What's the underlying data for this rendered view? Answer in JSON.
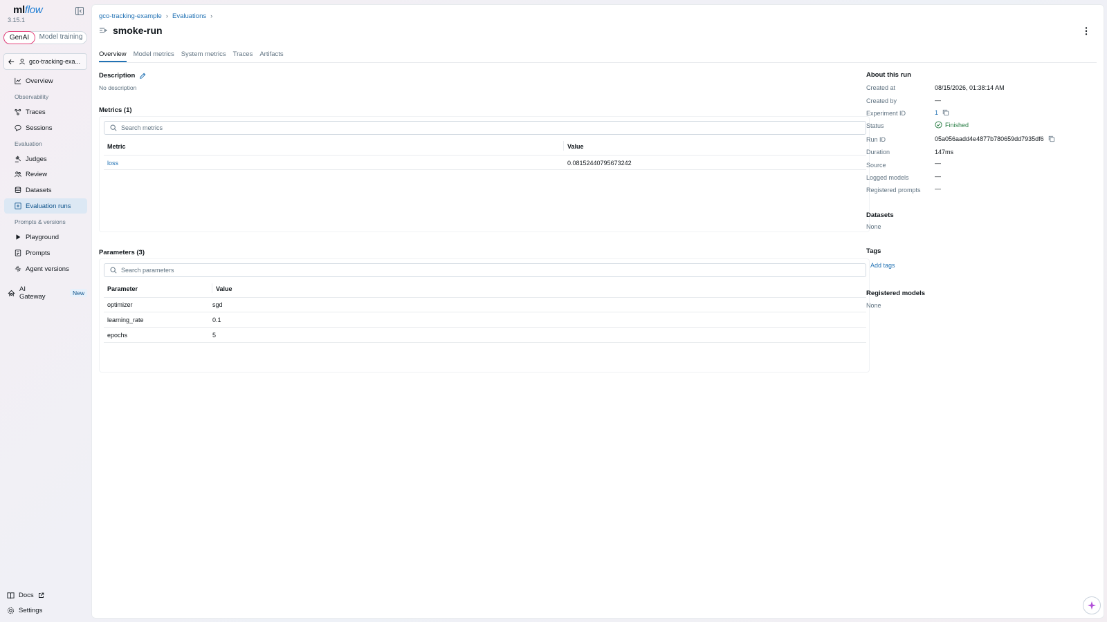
{
  "app": {
    "logo_main": "ml",
    "logo_accent": "flow",
    "version": "3.15.1"
  },
  "mode_switch": {
    "genai": "GenAI",
    "model_training": "Model training"
  },
  "experiment": {
    "name": "gco-tracking-exa..."
  },
  "sidebar": {
    "overview": "Overview",
    "group_observability": "Observability",
    "traces": "Traces",
    "sessions": "Sessions",
    "group_evaluation": "Evaluation",
    "judges": "Judges",
    "review": "Review",
    "datasets": "Datasets",
    "evaluation_runs": "Evaluation runs",
    "group_prompts": "Prompts & versions",
    "playground": "Playground",
    "prompts": "Prompts",
    "agent_versions": "Agent versions",
    "ai_gateway": "AI Gateway",
    "new_badge": "New",
    "docs": "Docs",
    "settings": "Settings"
  },
  "breadcrumb": {
    "experiment": "gco-tracking-example",
    "section": "Evaluations",
    "sep": "›"
  },
  "page": {
    "title": "smoke-run"
  },
  "tabs": [
    "Overview",
    "Model metrics",
    "System metrics",
    "Traces",
    "Artifacts"
  ],
  "description": {
    "title": "Description",
    "value": "No description"
  },
  "metrics": {
    "title": "Metrics (1)",
    "search_placeholder": "Search metrics",
    "col_metric": "Metric",
    "col_value": "Value",
    "rows": [
      {
        "name": "loss",
        "value": "0.08152440795673242"
      }
    ]
  },
  "parameters": {
    "title": "Parameters (3)",
    "search_placeholder": "Search parameters",
    "col_param": "Parameter",
    "col_value": "Value",
    "rows": [
      {
        "name": "optimizer",
        "value": "sgd"
      },
      {
        "name": "learning_rate",
        "value": "0.1"
      },
      {
        "name": "epochs",
        "value": "5"
      }
    ]
  },
  "about": {
    "title": "About this run",
    "created_at_label": "Created at",
    "created_at": "08/15/2026, 01:38:14 AM",
    "created_by_label": "Created by",
    "created_by": "—",
    "experiment_id_label": "Experiment ID",
    "experiment_id": "1",
    "status_label": "Status",
    "status": "Finished",
    "run_id_label": "Run ID",
    "run_id": "05a056aadd4e4877b780659dd7935df6",
    "duration_label": "Duration",
    "duration": "147ms",
    "source_label": "Source",
    "source": "—",
    "logged_models_label": "Logged models",
    "logged_models": "—",
    "registered_prompts_label": "Registered prompts",
    "registered_prompts": "—",
    "datasets_title": "Datasets",
    "datasets": "None",
    "tags_title": "Tags",
    "add_tags": "Add tags",
    "registered_models_title": "Registered models",
    "registered_models": "None"
  },
  "colors": {
    "accent": "#2272b4",
    "active_nav_bg": "#dce8f4",
    "success": "#277c43",
    "genai_border": "#e4407a"
  }
}
